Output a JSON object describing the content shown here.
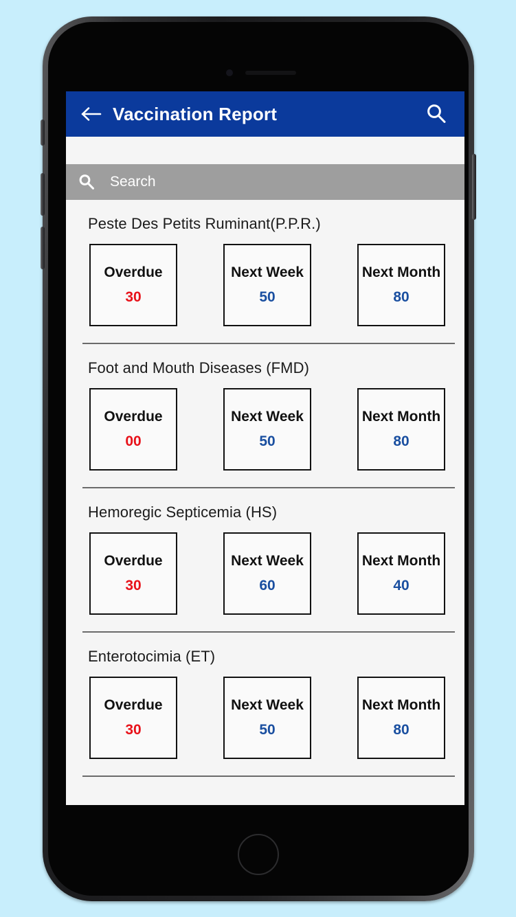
{
  "app_bar": {
    "back_icon": "arrow-left-icon",
    "title": "Vaccination Report",
    "search_icon": "search-icon"
  },
  "search": {
    "icon": "search-icon",
    "placeholder": "Search",
    "value": ""
  },
  "colors": {
    "app_bar_blue": "#0b3a9c",
    "search_bar_gray": "#9e9e9e",
    "overdue_red": "#e8121a",
    "upcoming_blue": "#1a4fa0",
    "page_background": "#c8eefc",
    "screen_background": "#f5f5f5",
    "divider_gray": "#6b6b6b"
  },
  "sections": [
    {
      "title": "Peste Des Petits Ruminant(P.P.R.)",
      "stats": [
        {
          "label": "Overdue",
          "value": "30",
          "kind": "overdue"
        },
        {
          "label": "Next Week",
          "value": "50",
          "kind": "upcoming"
        },
        {
          "label": "Next Month",
          "value": "80",
          "kind": "upcoming"
        }
      ]
    },
    {
      "title": "Foot and Mouth Diseases (FMD)",
      "stats": [
        {
          "label": "Overdue",
          "value": "00",
          "kind": "overdue"
        },
        {
          "label": "Next Week",
          "value": "50",
          "kind": "upcoming"
        },
        {
          "label": "Next Month",
          "value": "80",
          "kind": "upcoming"
        }
      ]
    },
    {
      "title": "Hemoregic Septicemia (HS)",
      "stats": [
        {
          "label": "Overdue",
          "value": "30",
          "kind": "overdue"
        },
        {
          "label": "Next Week",
          "value": "60",
          "kind": "upcoming"
        },
        {
          "label": "Next Month",
          "value": "40",
          "kind": "upcoming"
        }
      ]
    },
    {
      "title": "Enterotocimia (ET)",
      "stats": [
        {
          "label": "Overdue",
          "value": "30",
          "kind": "overdue"
        },
        {
          "label": "Next Week",
          "value": "50",
          "kind": "upcoming"
        },
        {
          "label": "Next Month",
          "value": "80",
          "kind": "upcoming"
        }
      ]
    }
  ],
  "device": {
    "home_button": "home-button",
    "power_button": "power-button",
    "volume_up": "volume-up-button",
    "volume_down": "volume-down-button",
    "silent_switch": "silent-switch",
    "earpiece": "earpiece-speaker",
    "front_camera": "front-camera"
  }
}
